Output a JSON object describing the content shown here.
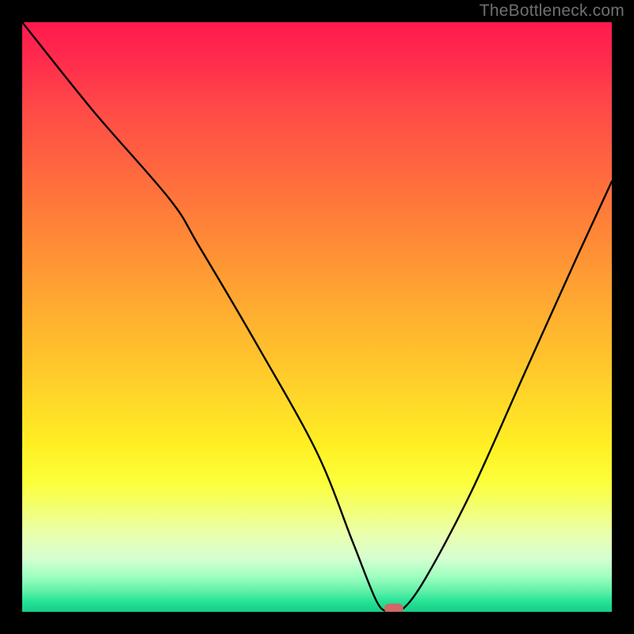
{
  "watermark": "TheBottleneck.com",
  "chart_data": {
    "type": "line",
    "title": "",
    "xlabel": "",
    "ylabel": "",
    "xlim": [
      0,
      100
    ],
    "ylim": [
      0,
      100
    ],
    "series": [
      {
        "name": "bottleneck-curve",
        "x": [
          0,
          12,
          25,
          30,
          40,
          50,
          56,
          60,
          62,
          64,
          68,
          76,
          85,
          94,
          100
        ],
        "values": [
          100,
          85,
          70,
          62,
          45,
          27,
          12,
          2,
          0,
          0,
          5,
          20,
          40,
          60,
          73
        ]
      }
    ],
    "marker": {
      "x": 63,
      "y": 0.5
    },
    "gradient_stops": [
      {
        "pos": 0,
        "color": "#ff1a4d"
      },
      {
        "pos": 0.5,
        "color": "#ffb030"
      },
      {
        "pos": 0.78,
        "color": "#fbff3a"
      },
      {
        "pos": 1.0,
        "color": "#18cf8a"
      }
    ]
  }
}
